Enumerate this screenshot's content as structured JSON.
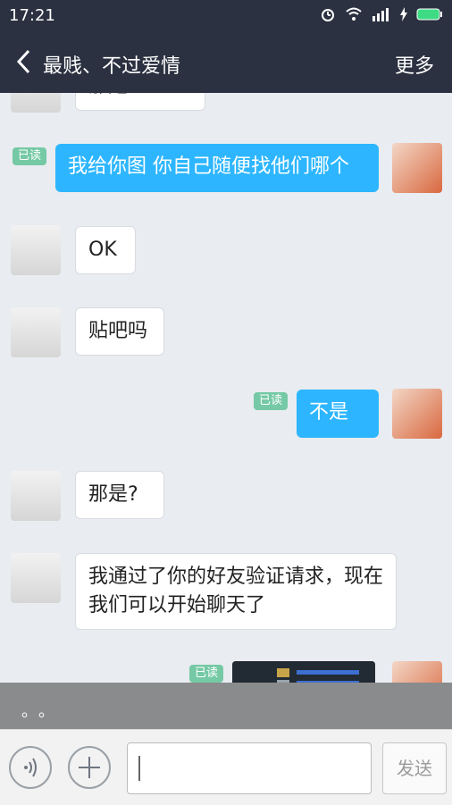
{
  "status_bar": {
    "time": "17:21"
  },
  "header": {
    "title": "最贱、不过爱情",
    "more_label": "更多"
  },
  "messages": [
    {
      "side": "left",
      "text": "那是"
    },
    {
      "side": "right",
      "read_label": "已读",
      "text": "我给你图  你自己随便找他们哪个"
    },
    {
      "side": "left",
      "text": "OK"
    },
    {
      "side": "left",
      "text": "贴吧吗"
    },
    {
      "side": "right",
      "read_label": "已读",
      "text": "不是"
    },
    {
      "side": "left",
      "text": "那是?"
    },
    {
      "side": "left",
      "text": "我通过了你的好友验证请求，现在我们可以开始聊天了"
    },
    {
      "side": "right",
      "read_label": "已读",
      "text": ""
    }
  ],
  "overlay": {
    "text": "。。"
  },
  "input_bar": {
    "placeholder": "",
    "send_label": "发送"
  },
  "colors": {
    "nav": "#2b3140",
    "bubble_self": "#2db6ff",
    "read_badge": "#75c9a5",
    "battery": "#3ddc84"
  }
}
